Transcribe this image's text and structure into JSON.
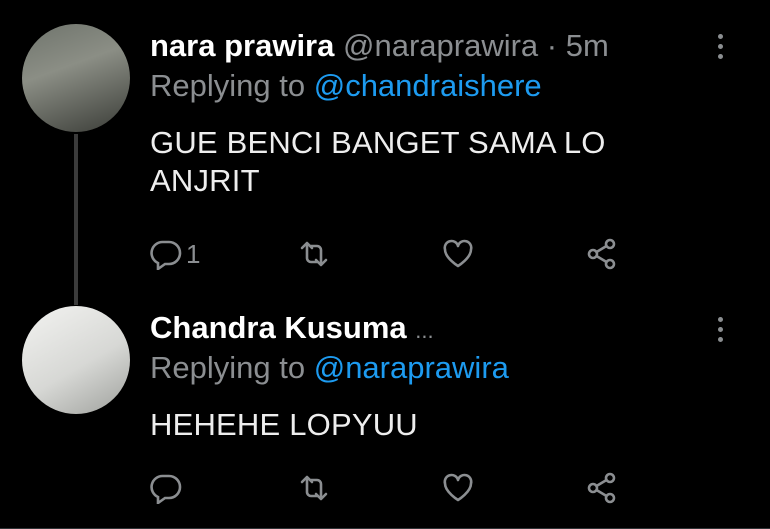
{
  "thread": [
    {
      "author_name": "nara prawira",
      "handle": "@naraprawira",
      "separator": "·",
      "time": "5m",
      "replying_prefix": "Replying to",
      "replying_to": "@chandraishere",
      "text": "GUE BENCI BANGET SAMA LO ANJRIT",
      "reply_count": "1",
      "avatar_icon": "profile-photo"
    },
    {
      "author_name": "Chandra Kusuma",
      "name_truncation": "...",
      "replying_prefix": "Replying to",
      "replying_to": "@naraprawira",
      "text": "HEHEHE LOPYUU",
      "reply_count": "",
      "avatar_icon": "profile-photo"
    }
  ],
  "icons": [
    "reply-icon",
    "retweet-icon",
    "like-icon",
    "share-icon",
    "more-options-icon"
  ],
  "colors": {
    "background": "#000000",
    "accent": "#1d9bf0",
    "muted": "#8b8e91",
    "text": "#eeeeee"
  }
}
